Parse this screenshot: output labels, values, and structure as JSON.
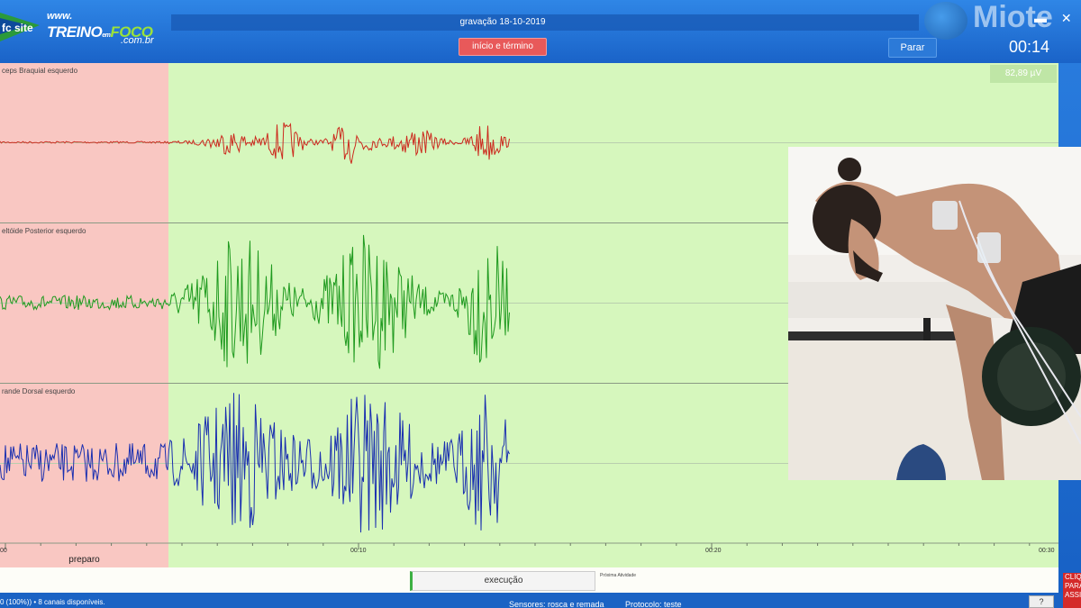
{
  "window": {
    "title": "gravação 18-10-2019",
    "controls": "▬ ✕"
  },
  "logo": {
    "prefix": "fc site",
    "www": "www.",
    "brand_a": "TREINO",
    "brand_sep": "em",
    "brand_b": "FOCO",
    "domain": ".com.br"
  },
  "watermark": {
    "text": "Miote"
  },
  "toolbar": {
    "start_end_label": "início e término",
    "stop_label": "Parar",
    "timer": "00:14"
  },
  "channels": [
    {
      "label": "ceps Braquial esquerdo",
      "color": "#cc2a1e"
    },
    {
      "label": "eltóide Posterior esquerdo",
      "color": "#1f9a1f"
    },
    {
      "label": "rande Dorsal esquerdo",
      "color": "#1a2fb0"
    }
  ],
  "amplitude_readout": "82,89 µV",
  "time_axis": {
    "ticks": [
      "00",
      "00:10",
      "00:20",
      "00:30"
    ]
  },
  "phases": {
    "prep_label": "preparo",
    "exec_label": "execução",
    "next_label": "Próxima Atividade"
  },
  "status": {
    "left": "0 (100%)) • 8 canais disponíveis.",
    "sensors": "Sensores: rosca e remada",
    "protocol": "Protocolo: teste",
    "help": "?",
    "side_ad": "CLIQ PARA ASSI"
  },
  "colors": {
    "prep_zone": "#f9c7c2",
    "active_zone": "#d6f7bd",
    "header": "#1a63c8"
  }
}
